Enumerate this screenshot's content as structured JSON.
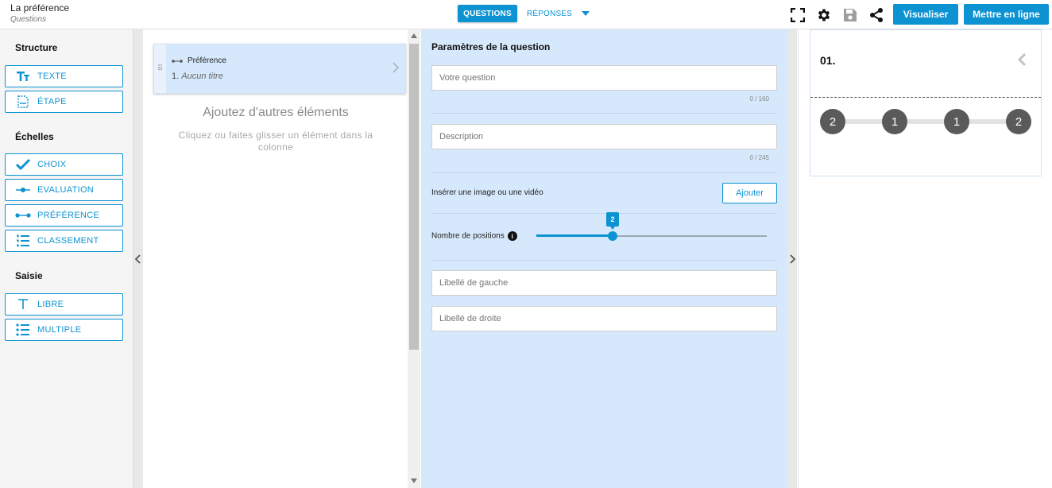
{
  "header": {
    "title": "La préférence",
    "subtitle": "Questions",
    "tab_questions": "QUESTIONS",
    "tab_reponses": "RÉPONSES",
    "btn_preview": "Visualiser",
    "btn_publish": "Mettre en ligne"
  },
  "palette": {
    "structure": "Structure",
    "texte": "TEXTE",
    "etape": "ÉTAPE",
    "echelles": "Échelles",
    "choix": "CHOIX",
    "evaluation": "EVALUATION",
    "preference": "PRÉFÉRENCE",
    "classement": "CLASSEMENT",
    "saisie": "Saisie",
    "libre": "LIBRE",
    "multiple": "MULTIPLE"
  },
  "questions": {
    "card_type": "Préférence",
    "card_index": "1.",
    "card_title": "Aucun titre",
    "empty_title": "Ajoutez d'autres éléments",
    "empty_sub": "Cliquez ou faites glisser un élément dans la colonne"
  },
  "settings": {
    "title": "Paramètres de la question",
    "question_placeholder": "Votre question",
    "question_counter": "0 / 160",
    "description_placeholder": "Description",
    "description_counter": "0 / 245",
    "media_label": "Insérer une image ou une vidéo",
    "add_button": "Ajouter",
    "positions_label": "Nombre de positions",
    "positions_value": "2",
    "positions_fraction": 0.33,
    "left_label_placeholder": "Libellé de gauche",
    "right_label_placeholder": "Libellé de droite"
  },
  "preview": {
    "number": "01.",
    "scale": [
      "2",
      "1",
      "1",
      "2"
    ]
  },
  "colors": {
    "accent": "#0d93d2",
    "panel": "#d6e8fb"
  }
}
